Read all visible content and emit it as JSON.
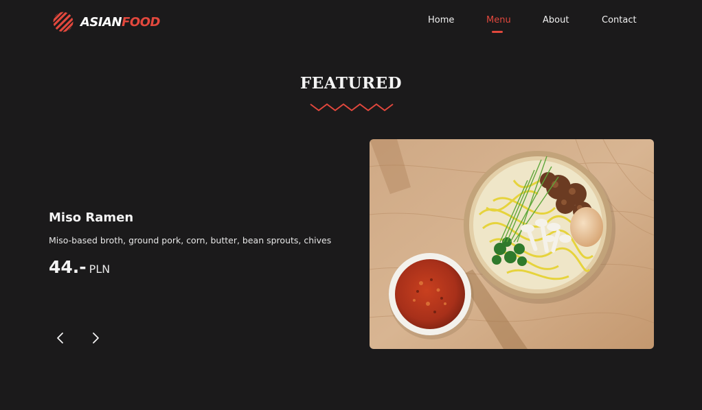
{
  "brand": {
    "name_part1": "ASIAN",
    "name_part2": "FOOD",
    "accent_color": "#e2483d"
  },
  "nav": {
    "items": [
      {
        "label": "Home",
        "active": false
      },
      {
        "label": "Menu",
        "active": true
      },
      {
        "label": "About",
        "active": false
      },
      {
        "label": "Contact",
        "active": false
      }
    ]
  },
  "section": {
    "title": "FEATURED"
  },
  "product": {
    "name": "Miso Ramen",
    "description": "Miso-based broth, ground pork, corn, butter, bean sprouts, chives",
    "price": "44.-",
    "currency": "PLN"
  },
  "carousel": {
    "prev_icon": "chevron-left-icon",
    "next_icon": "chevron-right-icon"
  },
  "theme": {
    "background": "#1b1a1b",
    "text": "#ffffff"
  }
}
